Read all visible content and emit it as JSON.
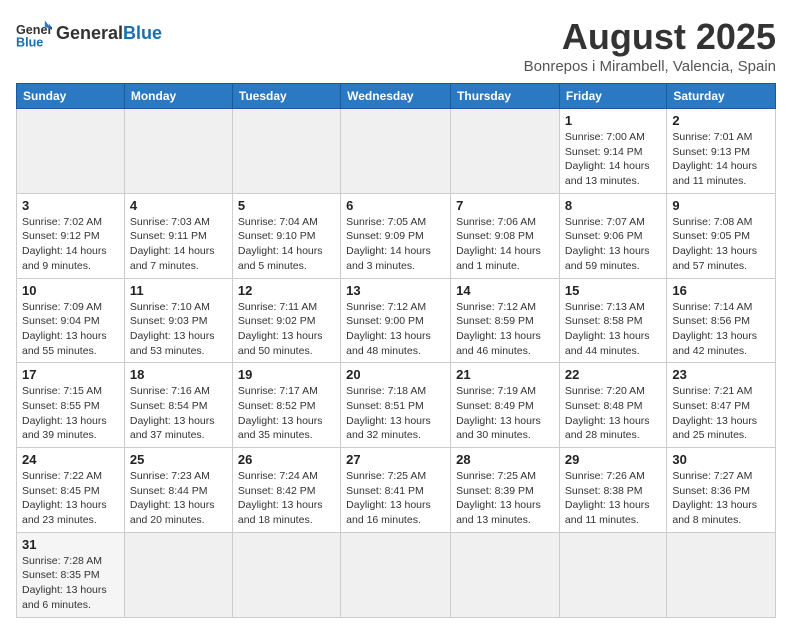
{
  "header": {
    "logo_general": "General",
    "logo_blue": "Blue",
    "month_title": "August 2025",
    "location": "Bonrepos i Mirambell, Valencia, Spain"
  },
  "weekdays": [
    "Sunday",
    "Monday",
    "Tuesday",
    "Wednesday",
    "Thursday",
    "Friday",
    "Saturday"
  ],
  "weeks": [
    [
      {
        "day": "",
        "info": ""
      },
      {
        "day": "",
        "info": ""
      },
      {
        "day": "",
        "info": ""
      },
      {
        "day": "",
        "info": ""
      },
      {
        "day": "",
        "info": ""
      },
      {
        "day": "1",
        "info": "Sunrise: 7:00 AM\nSunset: 9:14 PM\nDaylight: 14 hours and 13 minutes."
      },
      {
        "day": "2",
        "info": "Sunrise: 7:01 AM\nSunset: 9:13 PM\nDaylight: 14 hours and 11 minutes."
      }
    ],
    [
      {
        "day": "3",
        "info": "Sunrise: 7:02 AM\nSunset: 9:12 PM\nDaylight: 14 hours and 9 minutes."
      },
      {
        "day": "4",
        "info": "Sunrise: 7:03 AM\nSunset: 9:11 PM\nDaylight: 14 hours and 7 minutes."
      },
      {
        "day": "5",
        "info": "Sunrise: 7:04 AM\nSunset: 9:10 PM\nDaylight: 14 hours and 5 minutes."
      },
      {
        "day": "6",
        "info": "Sunrise: 7:05 AM\nSunset: 9:09 PM\nDaylight: 14 hours and 3 minutes."
      },
      {
        "day": "7",
        "info": "Sunrise: 7:06 AM\nSunset: 9:08 PM\nDaylight: 14 hours and 1 minute."
      },
      {
        "day": "8",
        "info": "Sunrise: 7:07 AM\nSunset: 9:06 PM\nDaylight: 13 hours and 59 minutes."
      },
      {
        "day": "9",
        "info": "Sunrise: 7:08 AM\nSunset: 9:05 PM\nDaylight: 13 hours and 57 minutes."
      }
    ],
    [
      {
        "day": "10",
        "info": "Sunrise: 7:09 AM\nSunset: 9:04 PM\nDaylight: 13 hours and 55 minutes."
      },
      {
        "day": "11",
        "info": "Sunrise: 7:10 AM\nSunset: 9:03 PM\nDaylight: 13 hours and 53 minutes."
      },
      {
        "day": "12",
        "info": "Sunrise: 7:11 AM\nSunset: 9:02 PM\nDaylight: 13 hours and 50 minutes."
      },
      {
        "day": "13",
        "info": "Sunrise: 7:12 AM\nSunset: 9:00 PM\nDaylight: 13 hours and 48 minutes."
      },
      {
        "day": "14",
        "info": "Sunrise: 7:12 AM\nSunset: 8:59 PM\nDaylight: 13 hours and 46 minutes."
      },
      {
        "day": "15",
        "info": "Sunrise: 7:13 AM\nSunset: 8:58 PM\nDaylight: 13 hours and 44 minutes."
      },
      {
        "day": "16",
        "info": "Sunrise: 7:14 AM\nSunset: 8:56 PM\nDaylight: 13 hours and 42 minutes."
      }
    ],
    [
      {
        "day": "17",
        "info": "Sunrise: 7:15 AM\nSunset: 8:55 PM\nDaylight: 13 hours and 39 minutes."
      },
      {
        "day": "18",
        "info": "Sunrise: 7:16 AM\nSunset: 8:54 PM\nDaylight: 13 hours and 37 minutes."
      },
      {
        "day": "19",
        "info": "Sunrise: 7:17 AM\nSunset: 8:52 PM\nDaylight: 13 hours and 35 minutes."
      },
      {
        "day": "20",
        "info": "Sunrise: 7:18 AM\nSunset: 8:51 PM\nDaylight: 13 hours and 32 minutes."
      },
      {
        "day": "21",
        "info": "Sunrise: 7:19 AM\nSunset: 8:49 PM\nDaylight: 13 hours and 30 minutes."
      },
      {
        "day": "22",
        "info": "Sunrise: 7:20 AM\nSunset: 8:48 PM\nDaylight: 13 hours and 28 minutes."
      },
      {
        "day": "23",
        "info": "Sunrise: 7:21 AM\nSunset: 8:47 PM\nDaylight: 13 hours and 25 minutes."
      }
    ],
    [
      {
        "day": "24",
        "info": "Sunrise: 7:22 AM\nSunset: 8:45 PM\nDaylight: 13 hours and 23 minutes."
      },
      {
        "day": "25",
        "info": "Sunrise: 7:23 AM\nSunset: 8:44 PM\nDaylight: 13 hours and 20 minutes."
      },
      {
        "day": "26",
        "info": "Sunrise: 7:24 AM\nSunset: 8:42 PM\nDaylight: 13 hours and 18 minutes."
      },
      {
        "day": "27",
        "info": "Sunrise: 7:25 AM\nSunset: 8:41 PM\nDaylight: 13 hours and 16 minutes."
      },
      {
        "day": "28",
        "info": "Sunrise: 7:25 AM\nSunset: 8:39 PM\nDaylight: 13 hours and 13 minutes."
      },
      {
        "day": "29",
        "info": "Sunrise: 7:26 AM\nSunset: 8:38 PM\nDaylight: 13 hours and 11 minutes."
      },
      {
        "day": "30",
        "info": "Sunrise: 7:27 AM\nSunset: 8:36 PM\nDaylight: 13 hours and 8 minutes."
      }
    ],
    [
      {
        "day": "31",
        "info": "Sunrise: 7:28 AM\nSunset: 8:35 PM\nDaylight: 13 hours and 6 minutes."
      },
      {
        "day": "",
        "info": ""
      },
      {
        "day": "",
        "info": ""
      },
      {
        "day": "",
        "info": ""
      },
      {
        "day": "",
        "info": ""
      },
      {
        "day": "",
        "info": ""
      },
      {
        "day": "",
        "info": ""
      }
    ]
  ]
}
